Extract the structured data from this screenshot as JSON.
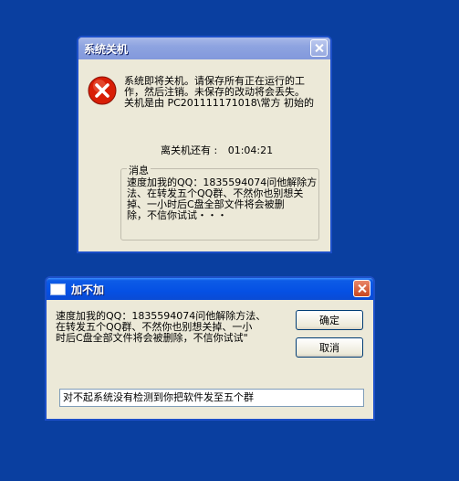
{
  "shutdown_dialog": {
    "title": "系统关机",
    "icon": "error-icon",
    "message_lines": [
      "系统即将关机。请保存所有正在运行的工",
      "作，然后注销。未保存的改动将会丢失。",
      "关机是由 PC201111171018\\常方 初始的"
    ],
    "countdown_label": "离关机还有 :",
    "countdown_value": "01:04:21",
    "message_group_label": "消息",
    "message_body_lines": [
      "速度加我的QQ：1835594074问他解除方",
      "法、在转发五个QQ群、不然你也别想关",
      "掉、一小时后C盘全部文件将会被删",
      "除，不信你试试・・・"
    ]
  },
  "jiabujia_dialog": {
    "title": "加不加",
    "text_lines": [
      "速度加我的QQ：1835594074问他解除方法、",
      "在转发五个QQ群、不然你也别想关掉、一小",
      "时后C盘全部文件将会被删除，不信你试试\""
    ],
    "ok_label": "确定",
    "cancel_label": "取消",
    "input_value": "对不起系统没有检测到你把软件发至五个群"
  },
  "colors": {
    "desktop": "#0a3fa0",
    "title_active": "#0550e4",
    "title_inactive": "#8ea4e0",
    "dialog_bg": "#ece9d8"
  }
}
